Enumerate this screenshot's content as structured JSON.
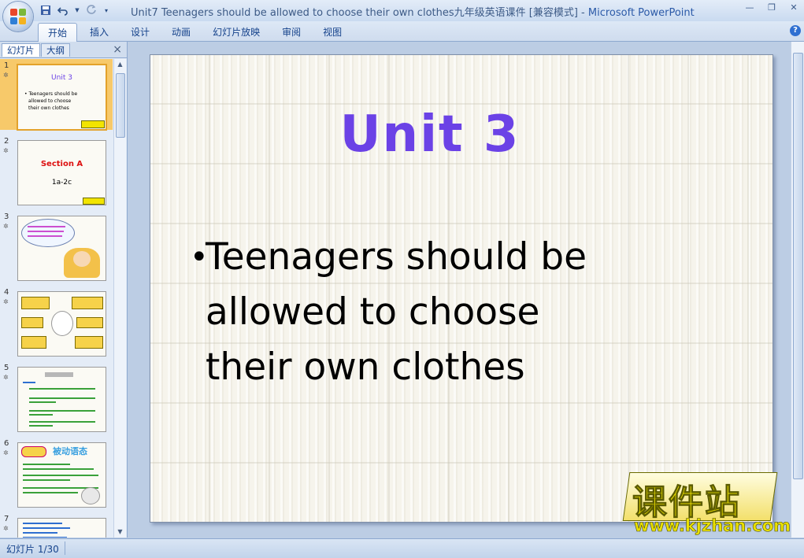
{
  "window": {
    "title_doc": "Unit7 Teenagers should be allowed to choose their own clothes九年级英语课件 [兼容模式]",
    "title_sep": " - ",
    "title_app": "Microsoft PowerPoint"
  },
  "qat": {
    "save_icon": "save-icon",
    "undo_icon": "undo-icon",
    "redo_icon": "redo-icon",
    "customize_icon": "dropdown-icon"
  },
  "ribbon": {
    "tabs": [
      {
        "label": "开始",
        "active": true
      },
      {
        "label": "插入"
      },
      {
        "label": "设计"
      },
      {
        "label": "动画"
      },
      {
        "label": "幻灯片放映"
      },
      {
        "label": "审阅"
      },
      {
        "label": "视图"
      }
    ],
    "help": "?"
  },
  "panel": {
    "tab_slides": "幻灯片",
    "tab_outline": "大纲",
    "close": "×",
    "thumbnails": [
      {
        "num": "1",
        "title": "Unit 3",
        "lines": [
          "• Teenagers should be",
          "allowed to choose",
          "their own clothes"
        ]
      },
      {
        "num": "2",
        "title": "Section A",
        "subtitle": "1a-2c"
      },
      {
        "num": "3"
      },
      {
        "num": "4"
      },
      {
        "num": "5"
      },
      {
        "num": "6",
        "title": "被动语态"
      },
      {
        "num": "7"
      }
    ]
  },
  "slide": {
    "title": "Unit  3",
    "bullet": "•",
    "body_lines": [
      "Teenagers should be",
      "allowed to choose",
      "their own clothes"
    ],
    "watermark_cn": "课件站",
    "watermark_url": "www.kjzhan.com"
  },
  "status": {
    "text": "幻灯片 1/30"
  },
  "colors": {
    "title_purple": "#6b42e6",
    "selection_orange": "#f7c96a",
    "ribbon_blue": "#15428b"
  }
}
